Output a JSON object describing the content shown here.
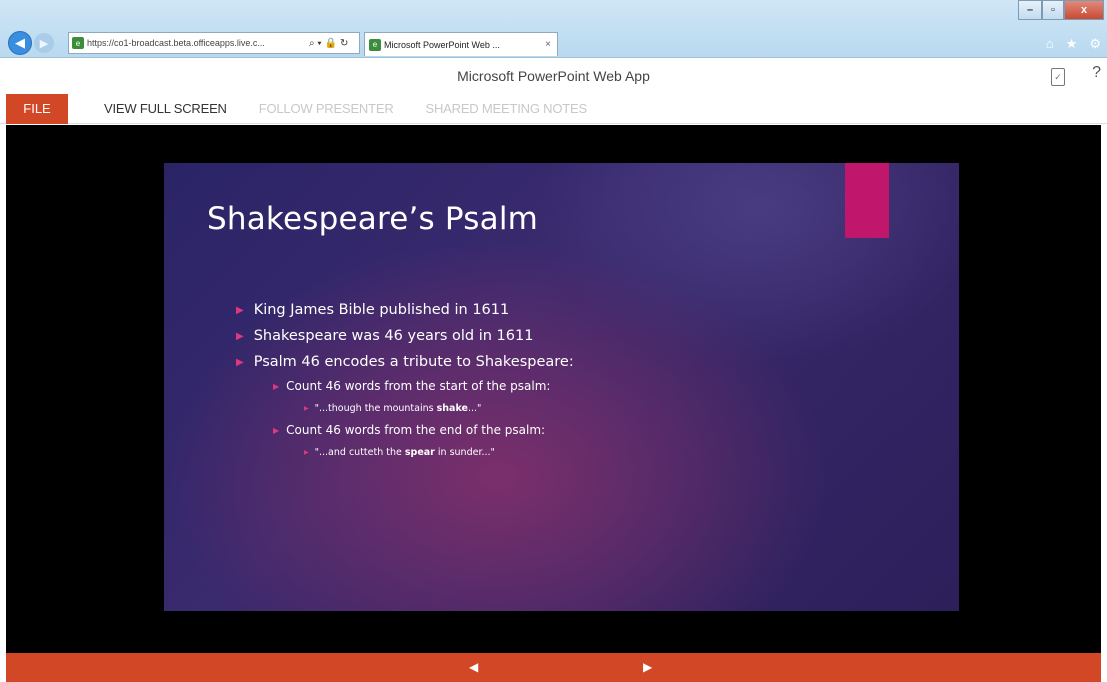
{
  "browser": {
    "url_prefix": "https://",
    "url_rest": "co1-broadcast.beta.officeapps.live.c...",
    "address_tools": [
      "⌕ ▾",
      "🔒",
      "↻"
    ],
    "tab_title": "Microsoft PowerPoint Web ...",
    "tab_close": "×",
    "window_buttons": {
      "minimize": "–",
      "maximize": "▫",
      "close": "x"
    },
    "tools": {
      "home": "⌂",
      "favorites": "★",
      "settings": "⚙"
    }
  },
  "app": {
    "title": "Microsoft PowerPoint Web App",
    "help": "?"
  },
  "ribbon": {
    "file": "FILE",
    "view_full_screen": "VIEW FULL SCREEN",
    "follow_presenter": "FOLLOW PRESENTER",
    "shared_meeting_notes": "SHARED MEETING NOTES"
  },
  "slide": {
    "title": "Shakespeare’s Psalm",
    "bullet_1": "King James Bible published in 1611",
    "bullet_2": "Shakespeare was 46 years old in 1611",
    "bullet_3": "Psalm 46 encodes a tribute to Shakespeare:",
    "sub_1": "Count 46 words from the start of the psalm:",
    "quote_1_pre": "\"...though the mountains ",
    "quote_1_bold": "shake",
    "quote_1_post": "...\"",
    "sub_2": "Count 46 words from the end of the psalm:",
    "quote_2_pre": "\"...and cutteth the ",
    "quote_2_bold": "spear",
    "quote_2_post": " in sunder...\"",
    "accent_color": "#c0176c"
  },
  "navigation": {
    "prev": "◀",
    "next": "▶",
    "bar_color": "#d24726"
  }
}
